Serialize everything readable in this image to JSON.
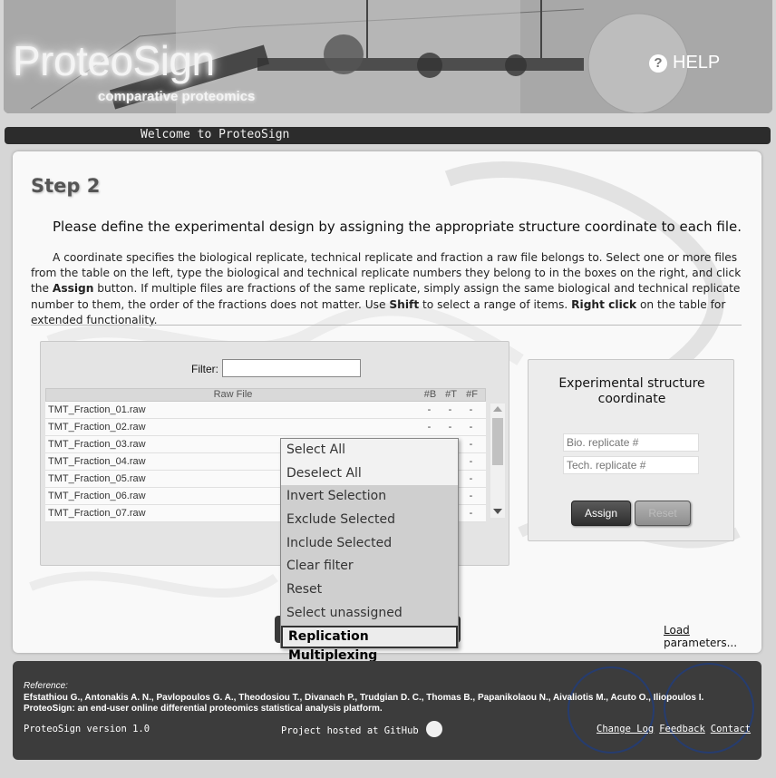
{
  "header": {
    "logo_title": "ProteoSign",
    "logo_subtitle": "comparative proteomics",
    "help_label": "HELP",
    "help_icon": "question-circle-icon"
  },
  "welcome_bar": {
    "text": "Welcome to ProteoSign"
  },
  "step": {
    "title": "Step 2",
    "intro": "Please define the experimental design by assigning the appropriate structure coordinate to each file.",
    "desc_part1": "A coordinate specifies the biological replicate, technical replicate and fraction a raw file belongs to. Select one or more files from the table on the left, type the biological and technical replicate numbers they belong to in the boxes on the right, and click the ",
    "desc_assign": "Assign",
    "desc_part2": " button. If multiple files are fractions of the same replicate, simply assign the same biological and technical replicate number to them, the order of the fractions does not matter. Use ",
    "desc_shift": "Shift",
    "desc_part3": " to select a range of items. ",
    "desc_right_click": "Right click",
    "desc_part4": " on the table for extended functionality."
  },
  "file_table": {
    "filter_label": "Filter:",
    "filter_value": "",
    "columns": [
      "Raw File",
      "#B",
      "#T",
      "#F"
    ],
    "rows": [
      {
        "name": "TMT_Fraction_01.raw",
        "b": "-",
        "t": "-",
        "f": "-"
      },
      {
        "name": "TMT_Fraction_02.raw",
        "b": "-",
        "t": "-",
        "f": "-"
      },
      {
        "name": "TMT_Fraction_03.raw",
        "b": "-",
        "t": "-",
        "f": "-"
      },
      {
        "name": "TMT_Fraction_04.raw",
        "b": "-",
        "t": "-",
        "f": "-"
      },
      {
        "name": "TMT_Fraction_05.raw",
        "b": "-",
        "t": "-",
        "f": "-"
      },
      {
        "name": "TMT_Fraction_06.raw",
        "b": "-",
        "t": "-",
        "f": "-"
      },
      {
        "name": "TMT_Fraction_07.raw",
        "b": "-",
        "t": "-",
        "f": "-"
      }
    ]
  },
  "coordinate_panel": {
    "title": "Experimental structure coordinate",
    "bio_placeholder": "Bio. replicate #",
    "tech_placeholder": "Tech. replicate #",
    "assign_label": "Assign",
    "reset_label": "Reset"
  },
  "load_params": {
    "link": "Load",
    "rest": " parameters..."
  },
  "context_menu": {
    "items": [
      "Select All",
      "Deselect All",
      "Invert Selection",
      "Exclude Selected",
      "Include Selected",
      "Clear filter",
      "Reset",
      "Select unassigned",
      "Replication Multiplexing"
    ]
  },
  "footer": {
    "ref_label": "Reference:",
    "ref_authors": "Efstathiou G., Antonakis A. N., Pavlopoulos G. A., Theodosiou T., Divanach P., Trudgian D. C., Thomas B., Papanikolaou N., Aivaliotis M., Acuto O., Iliopoulos I.",
    "ref_paper": "ProteoSign: an end-user online differential proteomics statistical analysis platform.",
    "version": "ProteoSign version 1.0",
    "github_text": "Project hosted at GitHub",
    "links": [
      "Change Log",
      "Feedback",
      "Contact"
    ]
  }
}
